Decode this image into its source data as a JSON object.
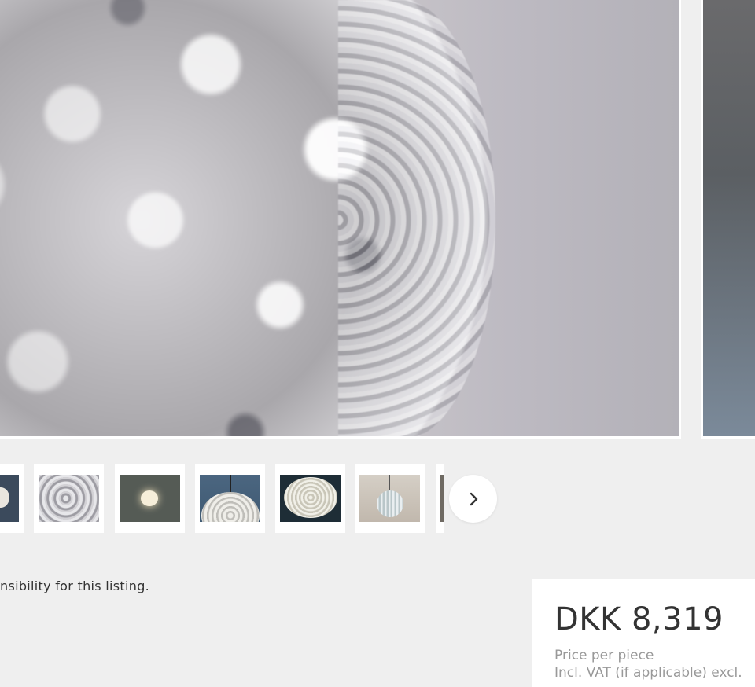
{
  "gallery": {
    "main_image_subject": "textured crystal glass pendant lamp close-up",
    "next_button_icon": "chevron-right-icon",
    "thumbnails": [
      {
        "subject": "glass globe lamp"
      },
      {
        "subject": "textured glass close-up"
      },
      {
        "subject": "lit globe pendant"
      },
      {
        "subject": "textured glass pendant"
      },
      {
        "subject": "textured globe lamp dark background"
      },
      {
        "subject": "ribbed glass pendant"
      },
      {
        "subject": "lamp photo"
      }
    ]
  },
  "listing": {
    "disclaimer": "nsibility for this listing."
  },
  "price": {
    "amount": "DKK 8,319",
    "per_unit": "Price per piece",
    "vat_note": "Incl. VAT (if applicable) excl."
  },
  "colors": {
    "page_background": "#efefef",
    "card_background": "#ffffff",
    "text_primary": "#333333",
    "text_muted": "#999999"
  }
}
